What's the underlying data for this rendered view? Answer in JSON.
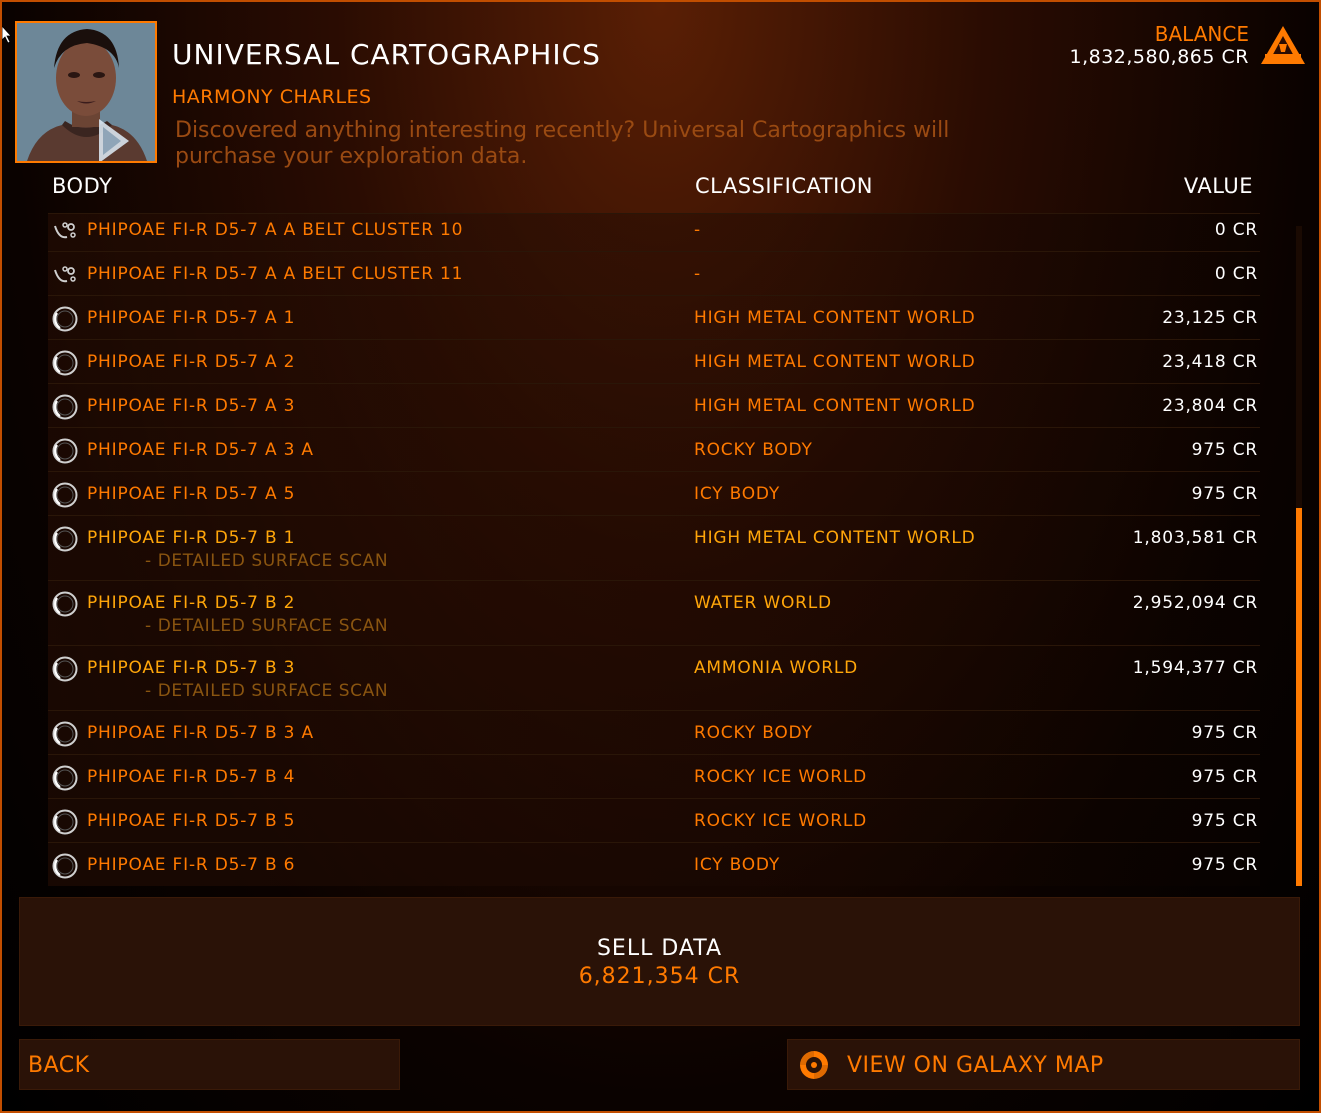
{
  "header": {
    "title": "UNIVERSAL CARTOGRAPHICS",
    "contact_name": "HARMONY CHARLES",
    "description": "Discovered anything interesting recently? Universal Cartographics will purchase your exploration data."
  },
  "balance": {
    "label": "BALANCE",
    "value": "1,832,580,865 CR"
  },
  "columns": {
    "body": "BODY",
    "classification": "CLASSIFICATION",
    "value": "VALUE"
  },
  "rows": [
    {
      "icon": "belt-cluster-icon",
      "name": "PHIPOAE FI-R D5-7 A A BELT CLUSTER 10",
      "sub": "",
      "classification": "-",
      "value": "0 CR"
    },
    {
      "icon": "belt-cluster-icon",
      "name": "PHIPOAE FI-R D5-7 A A BELT CLUSTER 11",
      "sub": "",
      "classification": "-",
      "value": "0 CR"
    },
    {
      "icon": "planet-icon",
      "name": "PHIPOAE FI-R D5-7 A 1",
      "sub": "",
      "classification": "HIGH METAL CONTENT WORLD",
      "value": "23,125 CR"
    },
    {
      "icon": "planet-icon",
      "name": "PHIPOAE FI-R D5-7 A 2",
      "sub": "",
      "classification": "HIGH METAL CONTENT WORLD",
      "value": "23,418 CR"
    },
    {
      "icon": "planet-icon",
      "name": "PHIPOAE FI-R D5-7 A 3",
      "sub": "",
      "classification": "HIGH METAL CONTENT WORLD",
      "value": "23,804 CR"
    },
    {
      "icon": "planet-icon",
      "name": "PHIPOAE FI-R D5-7 A 3 A",
      "sub": "",
      "classification": "ROCKY BODY",
      "value": "975 CR"
    },
    {
      "icon": "planet-icon",
      "name": "PHIPOAE FI-R D5-7 A 5",
      "sub": "",
      "classification": "ICY BODY",
      "value": "975 CR"
    },
    {
      "icon": "planet-icon",
      "name": "PHIPOAE FI-R D5-7 B 1",
      "sub": "- DETAILED SURFACE SCAN",
      "classification": "HIGH METAL CONTENT WORLD",
      "value": "1,803,581 CR"
    },
    {
      "icon": "planet-icon",
      "name": "PHIPOAE FI-R D5-7 B 2",
      "sub": "- DETAILED SURFACE SCAN",
      "classification": "WATER WORLD",
      "value": "2,952,094 CR"
    },
    {
      "icon": "planet-icon",
      "name": "PHIPOAE FI-R D5-7 B 3",
      "sub": "- DETAILED SURFACE SCAN",
      "classification": "AMMONIA WORLD",
      "value": "1,594,377 CR"
    },
    {
      "icon": "planet-icon",
      "name": "PHIPOAE FI-R D5-7 B 3 A",
      "sub": "",
      "classification": "ROCKY BODY",
      "value": "975 CR"
    },
    {
      "icon": "planet-icon",
      "name": "PHIPOAE FI-R D5-7 B 4",
      "sub": "",
      "classification": "ROCKY ICE WORLD",
      "value": "975 CR"
    },
    {
      "icon": "planet-icon",
      "name": "PHIPOAE FI-R D5-7 B 5",
      "sub": "",
      "classification": "ROCKY ICE WORLD",
      "value": "975 CR"
    },
    {
      "icon": "planet-icon",
      "name": "PHIPOAE FI-R D5-7 B 6",
      "sub": "",
      "classification": "ICY BODY",
      "value": "975 CR"
    }
  ],
  "sell": {
    "label": "SELL DATA",
    "value": "6,821,354 CR"
  },
  "buttons": {
    "back": "BACK",
    "galaxy_map": "VIEW ON GALAXY MAP"
  },
  "colors": {
    "accent": "#ff7a00",
    "highlight": "#ffa60a",
    "text": "#ffffff",
    "panel": "#2a1207"
  }
}
